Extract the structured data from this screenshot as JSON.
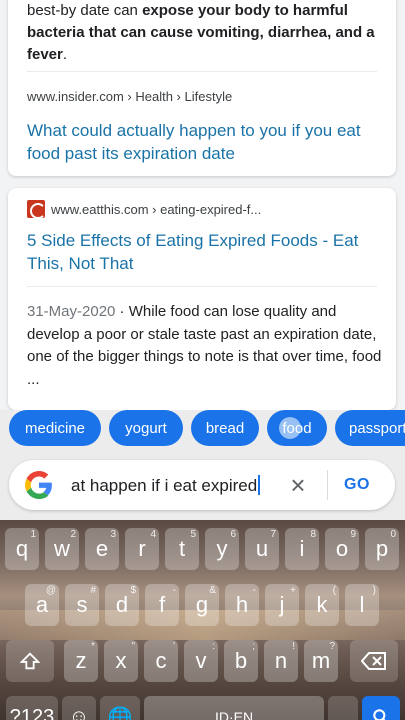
{
  "results": [
    {
      "snippet_prefix": "best-by date can ",
      "snippet_bold": "expose your body to harmful bacteria that can cause vomiting, diarrhea, and a fever",
      "snippet_suffix": ".",
      "cite": "www.insider.com › Health › Lifestyle",
      "title": "What could actually happen to you if you eat food past its expiration date"
    },
    {
      "cite": "www.eatthis.com › eating-expired-f...",
      "title": "5 Side Effects of Eating Expired Foods - Eat This, Not That",
      "date": "31-May-2020",
      "date_sep": " · ",
      "snippet": "While food can lose quality and develop a poor or stale taste past an expiration date, one of the bigger things to note is that over time, food ..."
    }
  ],
  "chips": [
    "medicine",
    "yogurt",
    "bread",
    "food",
    "passport"
  ],
  "search": {
    "query": "at happen if i eat expired",
    "clear_icon": "close-icon",
    "go_label": "GO"
  },
  "keyboard": {
    "row1": [
      {
        "k": "q",
        "h": "1"
      },
      {
        "k": "w",
        "h": "2"
      },
      {
        "k": "e",
        "h": "3"
      },
      {
        "k": "r",
        "h": "4"
      },
      {
        "k": "t",
        "h": "5"
      },
      {
        "k": "y",
        "h": "6"
      },
      {
        "k": "u",
        "h": "7"
      },
      {
        "k": "i",
        "h": "8"
      },
      {
        "k": "o",
        "h": "9"
      },
      {
        "k": "p",
        "h": "0"
      }
    ],
    "row2": [
      {
        "k": "a",
        "h": "@"
      },
      {
        "k": "s",
        "h": "#"
      },
      {
        "k": "d",
        "h": "$"
      },
      {
        "k": "f",
        "h": "-"
      },
      {
        "k": "g",
        "h": "&"
      },
      {
        "k": "h",
        "h": "-"
      },
      {
        "k": "j",
        "h": "+"
      },
      {
        "k": "k",
        "h": "("
      },
      {
        "k": "l",
        "h": ")"
      }
    ],
    "row3": [
      {
        "k": "z",
        "h": "*"
      },
      {
        "k": "x",
        "h": "\""
      },
      {
        "k": "c",
        "h": "'"
      },
      {
        "k": "v",
        "h": ":"
      },
      {
        "k": "b",
        "h": ";"
      },
      {
        "k": "n",
        "h": "!"
      },
      {
        "k": "m",
        "h": "?"
      }
    ],
    "symbols_label": "?123",
    "space_label": "ID·EN",
    "shift_icon": "shift-icon",
    "backspace_icon": "backspace-icon",
    "emoji_icon": "emoji-icon",
    "globe_icon": "globe-icon",
    "search_icon": "search-icon"
  },
  "colors": {
    "chip_bg": "#1a73e8",
    "link": "#1a73a8",
    "go": "#1a73e8"
  }
}
